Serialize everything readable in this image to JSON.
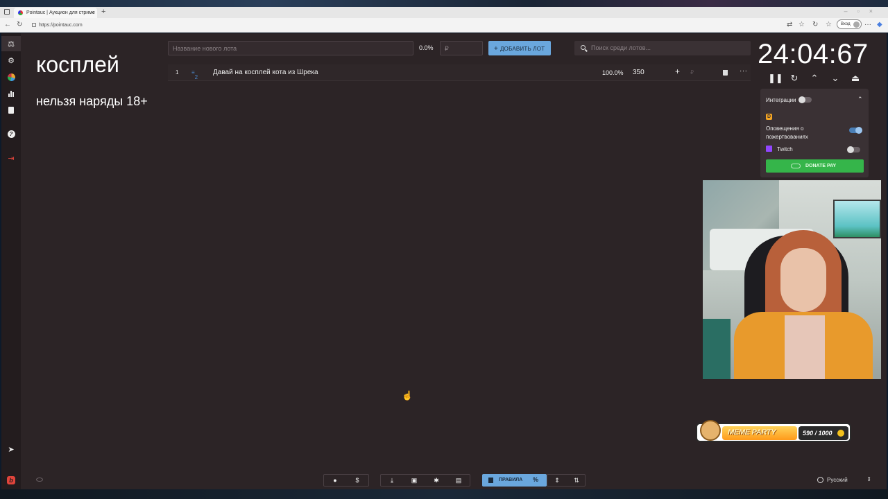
{
  "browser": {
    "tab_title": "Pointauc | Аукцион для стриме",
    "tab_close": "×",
    "new_tab": "+",
    "url": "https://pointauc.com",
    "signin_label": "Вход"
  },
  "auction": {
    "title": "косплей",
    "subtitle": "нельзя наряды 18+",
    "new_lot_placeholder": "Название нового лота",
    "percent_total": "0.0%",
    "amount_placeholder": "₽",
    "add_lot_label": "ДОБАВИТЬ ЛОТ",
    "search_placeholder": "Поиск среди лотов...",
    "lots": [
      {
        "index": "1",
        "fav_count": "2",
        "name": "Давай на косплей кота из Шрека",
        "percent": "100.0%",
        "amount": "350",
        "currency": "₽"
      }
    ]
  },
  "timer": {
    "value": "24:04:67"
  },
  "integrations": {
    "header": "Интеграции",
    "enabled": false,
    "donationalerts_label": "Оповещения о пожертвованиях",
    "donationalerts_on": true,
    "twitch_label": "Twitch",
    "twitch_on": false,
    "donatepay_label": "DONATE PAY"
  },
  "bottom_bar": {
    "rules_label": "ПРАВИЛА",
    "percent_symbol": "%"
  },
  "overlay": {
    "meme_party_label": "MEME PARTY",
    "meme_counter": "590 / 1000",
    "language": "Русский"
  },
  "colors": {
    "app_bg": "#2c2426",
    "accent_blue": "#6aa7dd",
    "donate_green": "#35b54a",
    "logout_red": "#e0443b",
    "twitch_purple": "#9146ff"
  }
}
